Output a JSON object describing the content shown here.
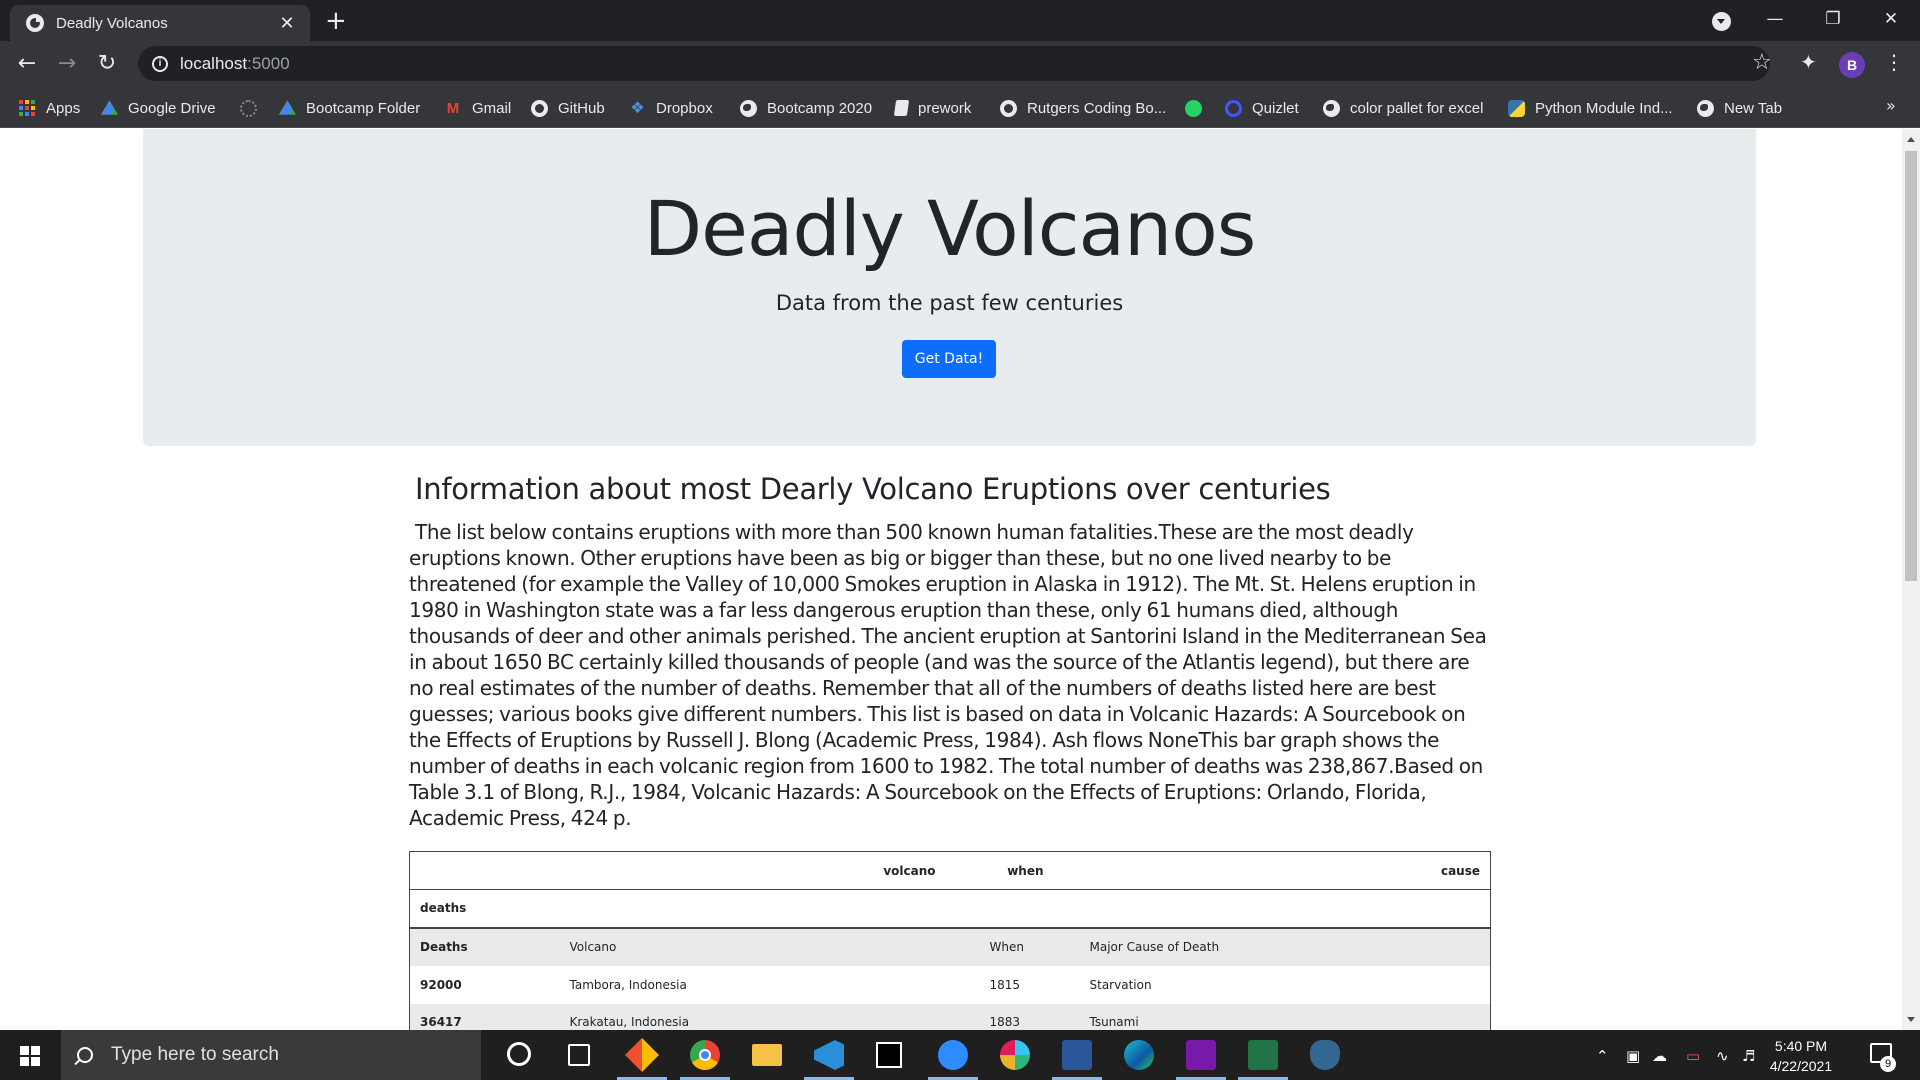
{
  "browser": {
    "tab_title": "Deadly Volcanos",
    "tab_close": "✕",
    "new_tab": "+",
    "url_host": "localhost",
    "url_port": ":5000",
    "bookmarks": [
      {
        "label": "Apps",
        "icon": "apps-grid-icon"
      },
      {
        "label": "Google Drive",
        "icon": "google-drive-icon"
      },
      {
        "label": "",
        "icon": "extension-placeholder-icon"
      },
      {
        "label": "Bootcamp Folder",
        "icon": "google-drive-icon"
      },
      {
        "label": "Gmail",
        "icon": "gmail-icon"
      },
      {
        "label": "GitHub",
        "icon": "github-icon"
      },
      {
        "label": "Dropbox",
        "icon": "dropbox-icon"
      },
      {
        "label": "Bootcamp 2020",
        "icon": "globe-icon"
      },
      {
        "label": "prework",
        "icon": "page-icon"
      },
      {
        "label": "Rutgers Coding Bo...",
        "icon": "github-icon"
      },
      {
        "label": "",
        "icon": "whatsapp-icon"
      },
      {
        "label": "Quizlet",
        "icon": "quizlet-icon"
      },
      {
        "label": "color pallet for excel",
        "icon": "globe-icon"
      },
      {
        "label": "Python Module Ind...",
        "icon": "python-icon"
      },
      {
        "label": "New Tab",
        "icon": "globe-icon"
      }
    ],
    "bookmarks_more": "»",
    "profile_initial": "B"
  },
  "page": {
    "title": "Deadly Volcanos",
    "subtitle": "Data from the past few centuries",
    "button_label": "Get Data!",
    "heading": "Information about most Dearly Volcano Eruptions over centuries",
    "paragraph": "The list below contains eruptions with more than 500 known human fatalities.These are the most deadly eruptions known. Other eruptions have been as big or bigger than these, but no one lived nearby to be threatened (for example the Valley of 10,000 Smokes eruption in Alaska in 1912). The Mt. St. Helens eruption in 1980 in Washington state was a far less dangerous eruption than these, only 61 humans died, although thousands of deer and other animals perished. The ancient eruption at Santorini Island in the Mediterranean Sea in about 1650 BC certainly killed thousands of people (and was the source of the Atlantis legend), but there are no real estimates of the number of deaths. Remember that all of the numbers of deaths listed here are best guesses; various books give different numbers. This list is based on data in Volcanic Hazards: A Sourcebook on the Effects of Eruptions by Russell J. Blong (Academic Press, 1984). Ash flows    NoneThis bar graph shows the number of deaths in each volcanic region from 1600 to 1982. The total number of deaths was 238,867.Based on Table 3.1 of Blong, R.J., 1984, Volcanic Hazards: A Sourcebook on the Effects of Eruptions: Orlando, Florida, Academic Press, 424 p."
  },
  "table": {
    "header": {
      "c1": "",
      "volcano": "volcano",
      "when": "when",
      "cause": "cause"
    },
    "index_name": "deaths",
    "column_row": {
      "deaths": "Deaths",
      "volcano": "Volcano",
      "when": "When",
      "cause": "Major Cause of Death"
    },
    "rows": [
      {
        "deaths": "92000",
        "volcano": "Tambora, Indonesia",
        "when": "1815",
        "cause": "Starvation"
      },
      {
        "deaths": "36417",
        "volcano": "Krakatau, Indonesia",
        "when": "1883",
        "cause": "Tsunami"
      }
    ]
  },
  "taskbar": {
    "search_placeholder": "Type here to search",
    "time": "5:40 PM",
    "date": "4/22/2021",
    "notification_count": "9"
  }
}
